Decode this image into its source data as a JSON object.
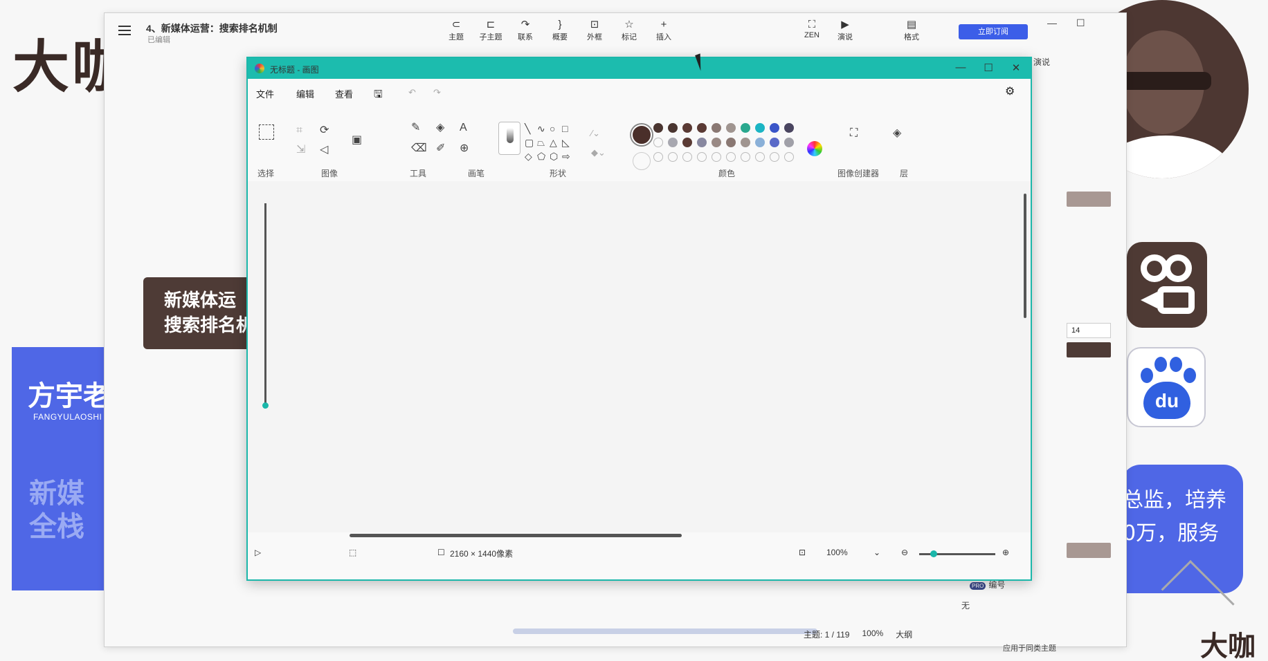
{
  "background": {
    "brand_text": "大咖",
    "blue_card_title": "方宇老",
    "blue_card_subtitle": "FANGYULAOSHI",
    "blue_card_faded_line1": "新媒",
    "blue_card_faded_line2": "全栈",
    "right_card_line1": "总监，培养",
    "right_card_line2": "0万，服务",
    "baidu_logo_text": "du",
    "bottom_logo_text": "大咖"
  },
  "mindmap_app": {
    "title": "4、新媒体运营：搜索排名机制",
    "subtitle": "已编辑",
    "toolbar": [
      {
        "label": "主题",
        "icon": "⊂"
      },
      {
        "label": "子主题",
        "icon": "⊏"
      },
      {
        "label": "联系",
        "icon": "↷"
      },
      {
        "label": "概要",
        "icon": "}"
      },
      {
        "label": "外框",
        "icon": "⊡"
      },
      {
        "label": "标记",
        "icon": "☆"
      },
      {
        "label": "插入",
        "icon": "+"
      }
    ],
    "toolbar_right": [
      {
        "label": "ZEN",
        "icon": "⛶"
      },
      {
        "label": "演说",
        "icon": "▶"
      },
      {
        "label": "格式",
        "icon": "▤"
      }
    ],
    "subscribe_button": "立即订阅",
    "root_node_line1": "新媒体运",
    "root_node_line2": "搜索排名机",
    "panel": {
      "tab_label": "演说",
      "font_size": "14",
      "numbering_label": "编号",
      "numbering_badge": "PRO",
      "numbering_value": "无",
      "apply_label": "应用于同类主题"
    },
    "status": {
      "topic_count": "主题: 1 / 119",
      "zoom": "100%",
      "outline": "大纲"
    },
    "colors": {
      "root_node": "#4e3b36",
      "accent": "#3c5ee8",
      "swatch_1": "#a89893",
      "swatch_2": "#4e3b36"
    }
  },
  "paint_app": {
    "title": "无标题 - 画图",
    "menu": {
      "file": "文件",
      "edit": "编辑",
      "view": "查看"
    },
    "groups": {
      "select": "选择",
      "image": "图像",
      "tools": "工具",
      "brushes": "画笔",
      "shapes": "形状",
      "colors": "颜色",
      "image_creator": "图像创建器",
      "layers": "层"
    },
    "palette_row1": [
      "#4a3530",
      "#4a3530",
      "#5a3a34",
      "#5a3a34",
      "#8a7873",
      "#a09590",
      "#2aa88e",
      "#1cb5c4",
      "#3a55c8",
      "#4a4560"
    ],
    "palette_row2": [
      "",
      "#a8a8b0",
      "#5a3a34",
      "#8888a0",
      "#9a8a85",
      "#8a7873",
      "#a09590",
      "#8ab0d8",
      "#5a6ac8",
      "#a0a0a8"
    ],
    "primary_color": "#4a2f2a",
    "status": {
      "canvas_size": "2160 × 1440像素",
      "zoom": "100%"
    }
  }
}
